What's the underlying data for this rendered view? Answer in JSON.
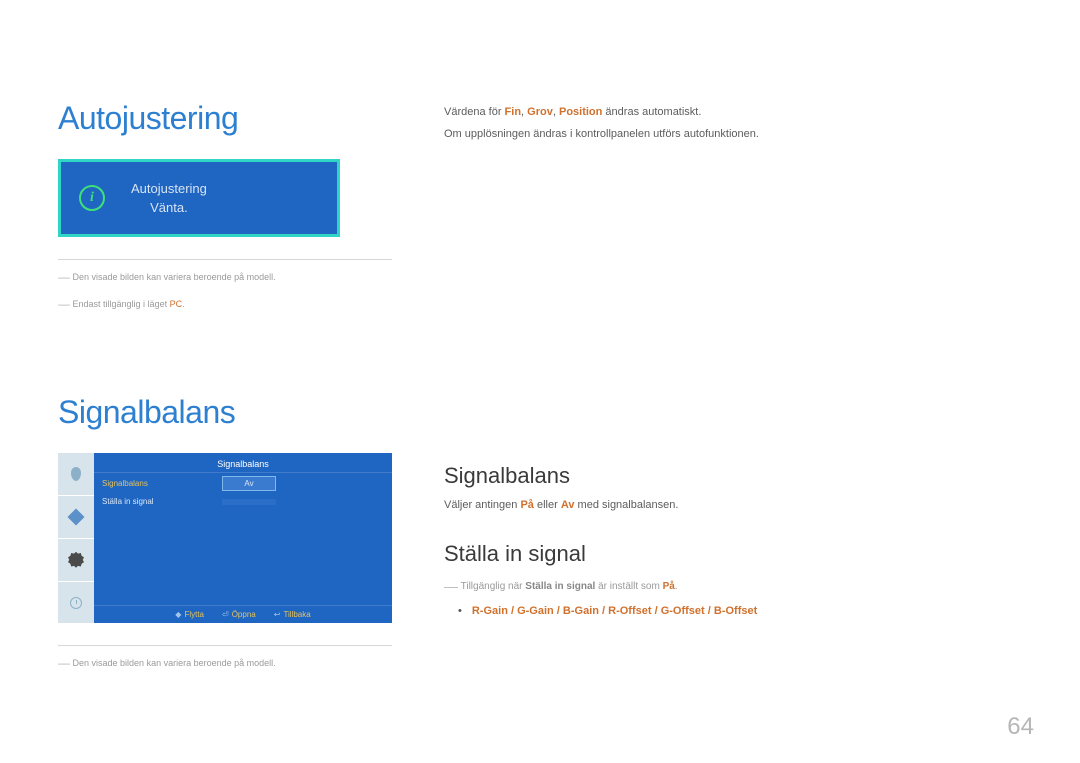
{
  "left": {
    "heading1": "Autojustering",
    "dialog": {
      "line1": "Autojustering",
      "line2": "Vänta."
    },
    "foot1_prefix": "Den visade bilden kan variera beroende på modell.",
    "foot2_prefix": "Endast tillgänglig i läget ",
    "foot2_accent": "PC",
    "heading2": "Signalbalans",
    "osd": {
      "title": "Signalbalans",
      "row1_label": "Signalbalans",
      "row1_value": "Av",
      "row2_label": "Ställa in signal",
      "row2_value": "",
      "footer": {
        "move": "Flytta",
        "open": "Öppna",
        "back": "Tillbaka"
      }
    },
    "foot3": "Den visade bilden kan variera beroende på modell."
  },
  "right": {
    "line1_pre": "Värdena för ",
    "line1_b1": "Fin",
    "line1_sep": ", ",
    "line1_b2": "Grov",
    "line1_b3": "Position",
    "line1_post": " ändras automatiskt.",
    "line2": "Om upplösningen ändras i kontrollpanelen utförs autofunktionen.",
    "h2a": "Signalbalans",
    "sb_text_pre": "Väljer antingen ",
    "sb_on": "På",
    "sb_mid": " eller ",
    "sb_off": "Av",
    "sb_text_post": " med signalbalansen.",
    "h2b": "Ställa in signal",
    "sis_note_pre": "Tillgänglig när ",
    "sis_note_bold": "Ställa in signal",
    "sis_note_mid": " är inställt som ",
    "sis_note_accent": "På",
    "bullet": "R-Gain / G-Gain / B-Gain / R-Offset / G-Offset / B-Offset"
  },
  "page_number": "64"
}
